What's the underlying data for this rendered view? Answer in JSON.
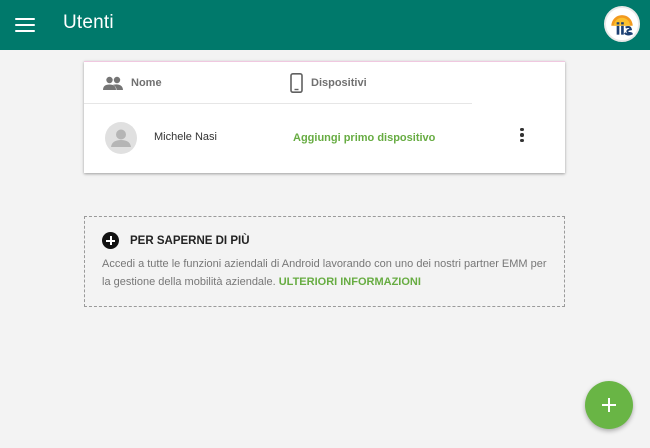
{
  "appbar": {
    "title": "Utenti",
    "menu_icon": "menu-icon",
    "account_icon": "account-logo-icon",
    "color": "#00796b"
  },
  "users_table": {
    "columns": [
      {
        "label": "Nome",
        "icon": "people-icon"
      },
      {
        "label": "Dispositivi",
        "icon": "smartphone-icon"
      }
    ],
    "rows": [
      {
        "name": "Michele Nasi",
        "action_label": "Aggiungi primo dispositivo",
        "more_icon": "more-vert-icon"
      }
    ]
  },
  "learn_more": {
    "title": "PER SAPERNE DI PIÙ",
    "text": "Accedi a tutte le funzioni aziendali di Android lavorando con uno dei nostri partner EMM per la gestione della mobilità aziendale.",
    "link_label": "ULTERIORI INFORMAZIONI",
    "icon": "add-circle-icon"
  },
  "fab": {
    "icon": "add-icon",
    "color": "#69b545"
  },
  "accent_color": "#67ac42"
}
